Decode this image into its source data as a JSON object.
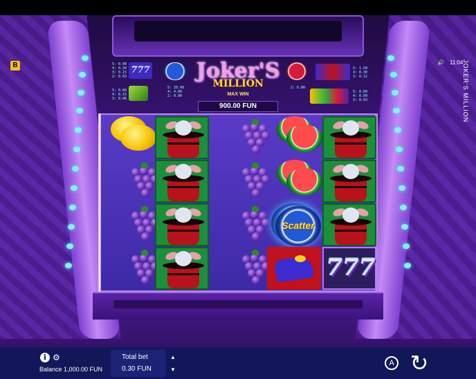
{
  "game": {
    "title": "JOKER'S MILLION",
    "logo_line1": "Joker'S",
    "logo_line2": "MILLION",
    "max_win_label": "MAX WIN",
    "max_win_value": "900.00 FUN",
    "badge": "B",
    "time": "11:04",
    "sound_icon": "speaker-icon"
  },
  "paytable": {
    "sevens": [
      "5: 0.00",
      "4: 0.30",
      "3: 0.15",
      "2: 0.03"
    ],
    "bells": [
      "5: 0.60",
      "4: 0.15",
      "3: 0.06"
    ],
    "scatter_blue": [
      "5: 20.00",
      "4: 4.00",
      "2: 0.90"
    ],
    "scatter_red": [
      "2: 6.00"
    ],
    "shoes": [
      "5: 1.50",
      "4: 0.30",
      "3: 0.12"
    ],
    "fruits": [
      "5: 0.00",
      "4: 0.09",
      "3: 0.03"
    ]
  },
  "reels": [
    [
      "lemon",
      "grape",
      "grape",
      "grape"
    ],
    [
      "rabbit",
      "rabbit",
      "rabbit",
      "rabbit"
    ],
    [
      "grape",
      "grape",
      "grape",
      "grape"
    ],
    [
      "melon",
      "melon",
      "scatter",
      "shoe"
    ],
    [
      "rabbit",
      "rabbit",
      "rabbit",
      "sevens"
    ]
  ],
  "symbols": {
    "scatter_label": "Scatter",
    "sevens_label": "777"
  },
  "bottom": {
    "balance": "Balance 1,000.00 FUN",
    "total_bet_label": "Total bet",
    "total_bet_value": "0.30 FUN",
    "auto_label": "A",
    "spin_icon": "↻",
    "info_label": "i",
    "settings_icon": "⚙"
  },
  "colors": {
    "background": "#3a1478",
    "bottom_bar": "#12175a",
    "accent_cyan": "#7ff3ff"
  }
}
